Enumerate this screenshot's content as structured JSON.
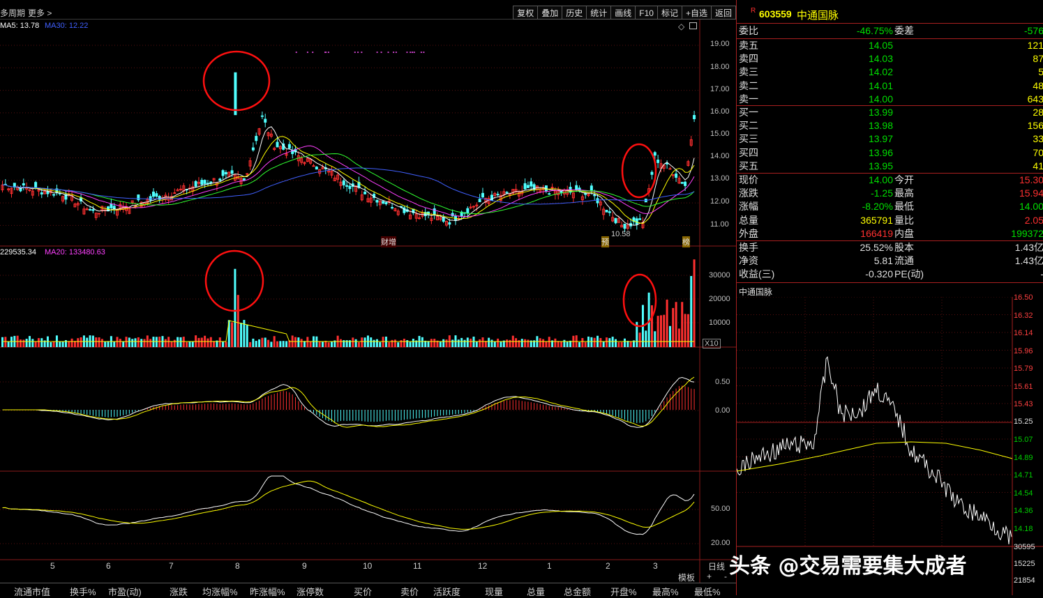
{
  "topbar": {
    "period_label": "多周期",
    "more_label": "更多 >",
    "toolbar": [
      "复权",
      "叠加",
      "历史",
      "统计",
      "画线",
      "F10",
      "标记",
      "+自选",
      "返回"
    ]
  },
  "price_panel": {
    "ma5_label": "MA5: 13.78",
    "ma30_label": "MA30: 12.22",
    "axis": [
      "19.00",
      "18.00",
      "17.00",
      "16.00",
      "15.00",
      "14.00",
      "13.00",
      "12.00",
      "11.00"
    ],
    "low_marker": "10.58",
    "event_tags": [
      "财增",
      "预",
      "榜"
    ]
  },
  "volume_panel": {
    "vol_label": "229535.34",
    "ma20_label": "MA20: 133480.63",
    "axis": [
      "30000",
      "20000",
      "10000"
    ],
    "unit": "X10"
  },
  "macd_panel": {
    "axis": [
      "0.50",
      "0.00"
    ]
  },
  "kdj_panel": {
    "axis": [
      "50.00",
      "20.00"
    ]
  },
  "xaxis": {
    "months": [
      "5",
      "6",
      "7",
      "8",
      "9",
      "10",
      "11",
      "12",
      "1",
      "2",
      "3"
    ],
    "daily_label": "日线",
    "template_label": "模板",
    "plus": "+",
    "minus": "-"
  },
  "bottom_tabs": [
    "流通市值",
    "换手%",
    "市盈(动)",
    "涨跌",
    "均涨幅%",
    "昨涨幅%",
    "涨停数",
    "买价",
    "卖价",
    "活跃度",
    "现量",
    "总量",
    "总金额",
    "开盘%",
    "最高%",
    "最低%"
  ],
  "quote": {
    "flag": "R",
    "code": "603559",
    "name": "中通国脉",
    "weibi_label": "委比",
    "weibi": "-46.75%",
    "weicha_label": "委差",
    "weicha": "-576",
    "asks": [
      {
        "label": "卖五",
        "price": "14.05",
        "vol": "121"
      },
      {
        "label": "卖四",
        "price": "14.03",
        "vol": "87"
      },
      {
        "label": "卖三",
        "price": "14.02",
        "vol": "5"
      },
      {
        "label": "卖二",
        "price": "14.01",
        "vol": "48"
      },
      {
        "label": "卖一",
        "price": "14.00",
        "vol": "643"
      }
    ],
    "bids": [
      {
        "label": "买一",
        "price": "13.99",
        "vol": "28"
      },
      {
        "label": "买二",
        "price": "13.98",
        "vol": "156"
      },
      {
        "label": "买三",
        "price": "13.97",
        "vol": "33"
      },
      {
        "label": "买四",
        "price": "13.96",
        "vol": "70"
      },
      {
        "label": "买五",
        "price": "13.95",
        "vol": "41"
      }
    ],
    "stats": [
      {
        "l1": "现价",
        "v1": "14.00",
        "c1": "g",
        "l2": "今开",
        "v2": "15.30",
        "c2": "r"
      },
      {
        "l1": "涨跌",
        "v1": "-1.25",
        "c1": "g",
        "l2": "最高",
        "v2": "15.94",
        "c2": "r"
      },
      {
        "l1": "涨幅",
        "v1": "-8.20%",
        "c1": "g",
        "l2": "最低",
        "v2": "14.00",
        "c2": "g"
      },
      {
        "l1": "总量",
        "v1": "365791",
        "c1": "y",
        "l2": "量比",
        "v2": "2.05",
        "c2": "r"
      },
      {
        "l1": "外盘",
        "v1": "166419",
        "c1": "r",
        "l2": "内盘",
        "v2": "199372",
        "c2": "g"
      }
    ],
    "stats2": [
      {
        "l1": "换手",
        "v1": "25.52%",
        "c1": "w",
        "l2": "股本",
        "v2": "1.43亿",
        "c2": "w"
      },
      {
        "l1": "净资",
        "v1": "5.81",
        "c1": "w",
        "l2": "流通",
        "v2": "1.43亿",
        "c2": "w"
      },
      {
        "l1": "收益(三)",
        "v1": "-0.320",
        "c1": "w",
        "l2": "PE(动)",
        "v2": "-",
        "c2": "w"
      }
    ]
  },
  "intraday": {
    "title": "中通国脉",
    "axis_up": [
      "16.50",
      "16.32",
      "16.14",
      "15.96",
      "15.79",
      "15.61",
      "15.43"
    ],
    "mid": "15.25",
    "axis_dn": [
      "15.07",
      "14.89",
      "14.71",
      "14.54",
      "14.36",
      "14.18"
    ],
    "vol_axis": [
      "30595",
      "15225",
      "21854"
    ]
  },
  "watermark": "头条 @交易需要集大成者"
}
